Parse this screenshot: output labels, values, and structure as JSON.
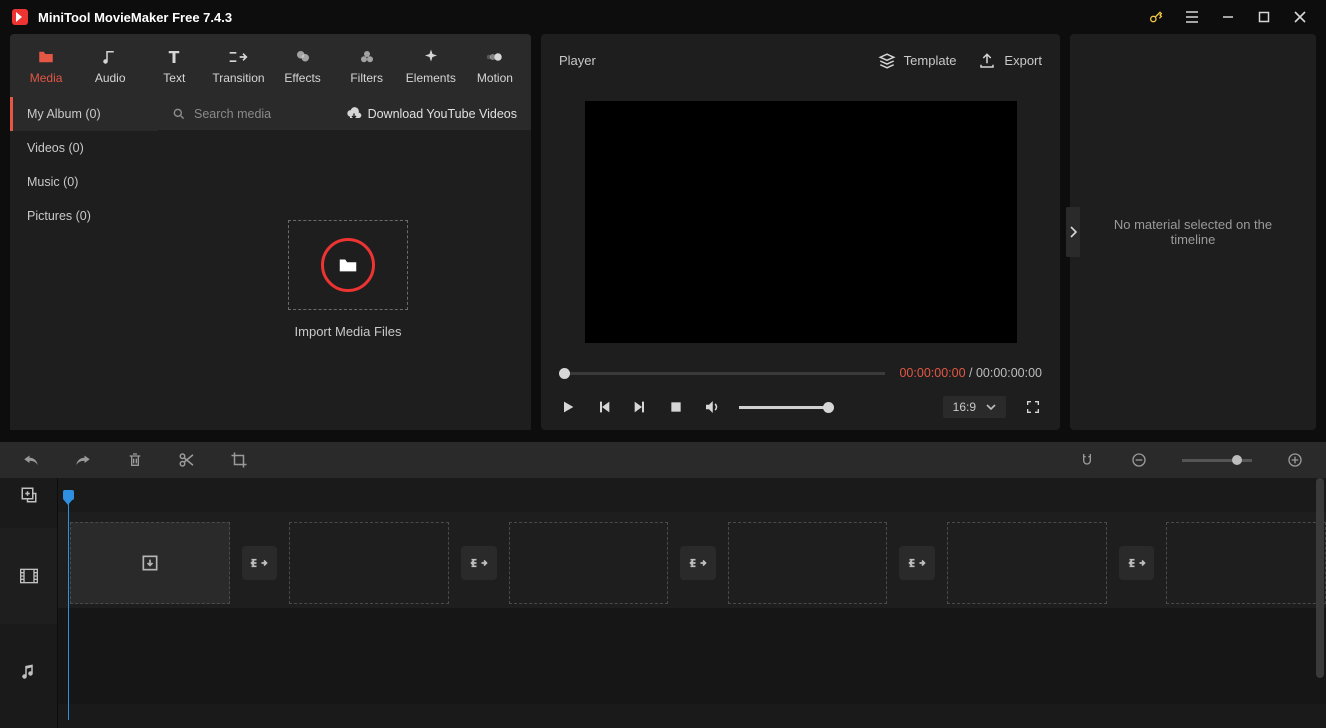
{
  "app": {
    "title": "MiniTool MovieMaker Free 7.4.3"
  },
  "tabs": {
    "media": "Media",
    "audio": "Audio",
    "text": "Text",
    "transition": "Transition",
    "effects": "Effects",
    "filters": "Filters",
    "elements": "Elements",
    "motion": "Motion"
  },
  "sidebar": {
    "my_album": "My Album (0)",
    "videos": "Videos (0)",
    "music": "Music (0)",
    "pictures": "Pictures (0)"
  },
  "search": {
    "placeholder": "Search media"
  },
  "download_link": "Download YouTube Videos",
  "import_label": "Import Media Files",
  "player": {
    "title": "Player",
    "template": "Template",
    "export": "Export",
    "tc_current": "00:00:00:00",
    "tc_sep": " / ",
    "tc_total": "00:00:00:00",
    "aspect": "16:9"
  },
  "right_panel": {
    "message": "No material selected on the timeline"
  }
}
